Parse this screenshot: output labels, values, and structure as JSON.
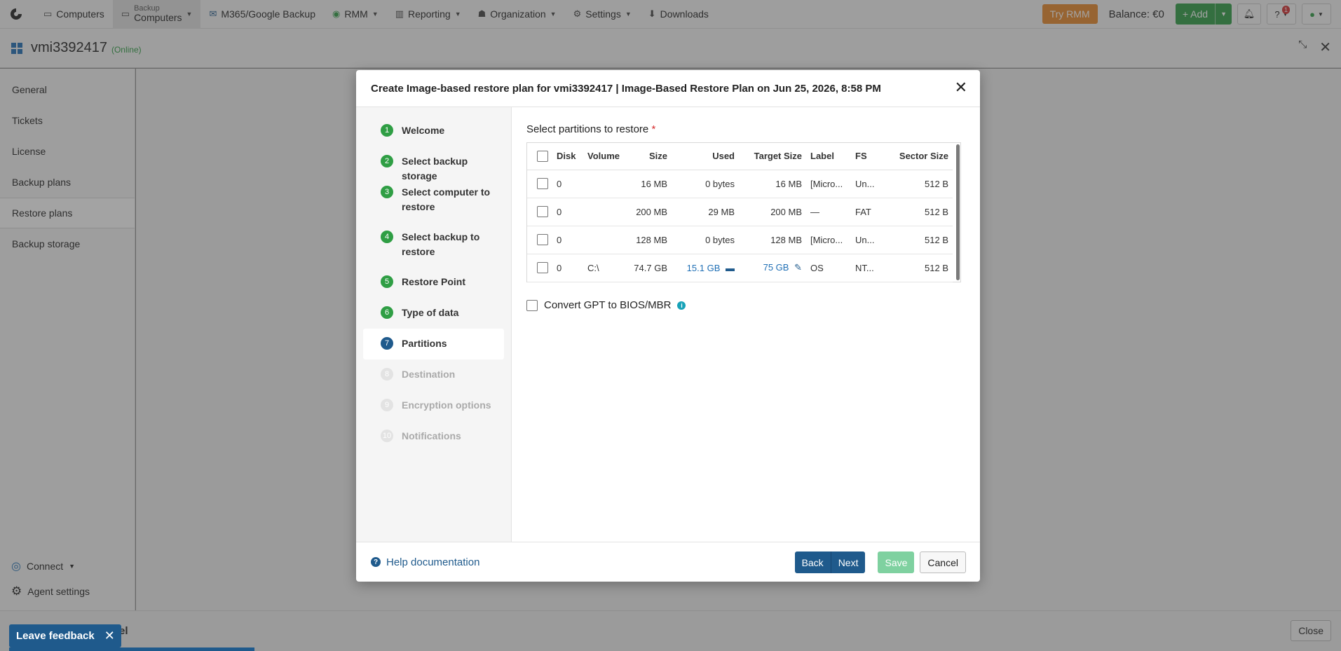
{
  "nav": {
    "items": [
      {
        "label": "Computers",
        "icon": "monitor-icon"
      },
      {
        "label_small": "Backup",
        "label": "Computers",
        "icon": "monitor-icon"
      },
      {
        "label": "M365/Google Backup",
        "icon": "envelope-icon"
      },
      {
        "label": "RMM",
        "icon": "rmm-icon"
      },
      {
        "label": "Reporting",
        "icon": "chart-icon"
      },
      {
        "label": "Organization",
        "icon": "users-icon"
      },
      {
        "label": "Settings",
        "icon": "gear-icon"
      },
      {
        "label": "Downloads",
        "icon": "download-icon"
      }
    ],
    "try_rmm": "Try RMM",
    "balance": "Balance: €0",
    "add": "Add",
    "help_badge": "1"
  },
  "computer": {
    "name": "vmi3392417",
    "status": "(Online)"
  },
  "sidebar": {
    "items": [
      "General",
      "Tickets",
      "License",
      "Backup plans",
      "Restore plans",
      "Backup storage"
    ],
    "connect": "Connect",
    "agent_settings": "Agent settings"
  },
  "bottom": {
    "feedback": "Leave feedback",
    "behind_label": "el",
    "close": "Close"
  },
  "modal": {
    "title": "Create Image-based restore plan for vmi3392417 | Image-Based Restore Plan on Jun 25, 2026, 8:58 PM",
    "steps": [
      {
        "num": "1",
        "label": "Welcome"
      },
      {
        "num": "2",
        "label": "Select backup storage"
      },
      {
        "num": "3",
        "label": "Select computer to restore"
      },
      {
        "num": "4",
        "label": "Select backup to restore"
      },
      {
        "num": "5",
        "label": "Restore Point"
      },
      {
        "num": "6",
        "label": "Type of data"
      },
      {
        "num": "7",
        "label": "Partitions"
      },
      {
        "num": "8",
        "label": "Destination"
      },
      {
        "num": "9",
        "label": "Encryption options"
      },
      {
        "num": "10",
        "label": "Notifications"
      }
    ],
    "section_title": "Select partitions to restore",
    "required_mark": "*",
    "table": {
      "headers": [
        "Disk",
        "Volume",
        "Size",
        "Used",
        "Target Size",
        "Label",
        "FS",
        "Sector Size"
      ],
      "rows": [
        {
          "disk": "0",
          "volume": "",
          "size": "16 MB",
          "used": "0 bytes",
          "target": "16 MB",
          "label": "[Micro...",
          "fs": "Un...",
          "sector": "512 B"
        },
        {
          "disk": "0",
          "volume": "",
          "size": "200 MB",
          "used": "29 MB",
          "target": "200 MB",
          "label": "—",
          "fs": "FAT",
          "sector": "512 B"
        },
        {
          "disk": "0",
          "volume": "",
          "size": "128 MB",
          "used": "0 bytes",
          "target": "128 MB",
          "label": "[Micro...",
          "fs": "Un...",
          "sector": "512 B"
        },
        {
          "disk": "0",
          "volume": "C:\\",
          "size": "74.7 GB",
          "used": "15.1 GB",
          "target": "75 GB",
          "label": "OS",
          "fs": "NT...",
          "sector": "512 B"
        }
      ]
    },
    "convert_label": "Convert GPT to BIOS/MBR",
    "help_link": "Help documentation",
    "buttons": {
      "back": "Back",
      "next": "Next",
      "save": "Save",
      "cancel": "Cancel"
    }
  }
}
